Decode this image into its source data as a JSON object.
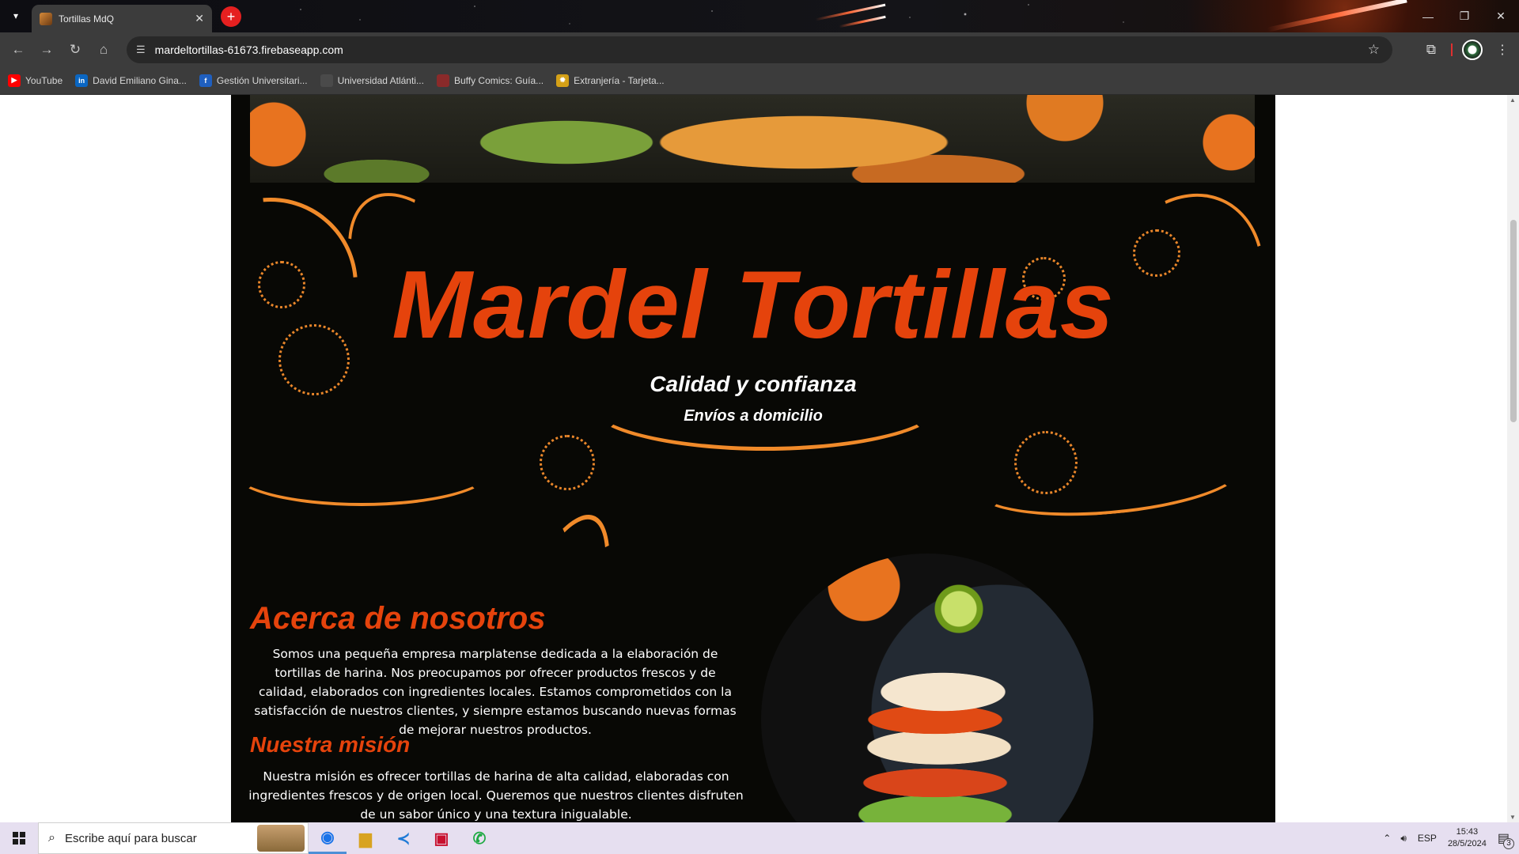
{
  "browser": {
    "tab_title": "Tortillas MdQ",
    "tab_close": "✕",
    "new_tab": "+",
    "url": "mardeltortillas-61673.firebaseapp.com",
    "bookmarks": [
      {
        "label": "YouTube",
        "icon": "youtube-icon",
        "color": "#ff0000"
      },
      {
        "label": "David Emiliano Gina...",
        "icon": "linkedin-icon",
        "color": "#0a66c2"
      },
      {
        "label": "Gestión Universitari...",
        "icon": "gestion-icon",
        "color": "#1f5fbf"
      },
      {
        "label": "Universidad Atlánti...",
        "icon": "universidad-icon",
        "color": "#4a4a4a"
      },
      {
        "label": "Buffy Comics: Guía...",
        "icon": "buffy-icon",
        "color": "#8a2a2a"
      },
      {
        "label": "Extranjería - Tarjeta...",
        "icon": "extranjeria-icon",
        "color": "#d4a017"
      }
    ]
  },
  "site": {
    "title": "Mardel Tortillas",
    "tagline": "Calidad y confianza",
    "subtagline": "Envíos a domicilio",
    "about_heading": "Acerca de nosotros",
    "about_text": "Somos una pequeña empresa marplatense dedicada a la elaboración de tortillas de harina. Nos preocupamos por ofrecer productos frescos y de calidad, elaborados con ingredientes locales. Estamos comprometidos con la satisfacción de nuestros clientes, y siempre estamos buscando nuevas formas de mejorar nuestros productos.",
    "mission_heading": "Nuestra misión",
    "mission_text": "Nuestra misión es ofrecer tortillas de harina de alta calidad, elaboradas con ingredientes frescos y de origen local. Queremos que nuestros clientes disfruten de un sabor único y una textura inigualable.",
    "accent_color": "#e5430c"
  },
  "taskbar": {
    "search_placeholder": "Escribe aquí para buscar",
    "language": "ESP",
    "time": "15:43",
    "date": "28/5/2024",
    "notifications": "3"
  }
}
